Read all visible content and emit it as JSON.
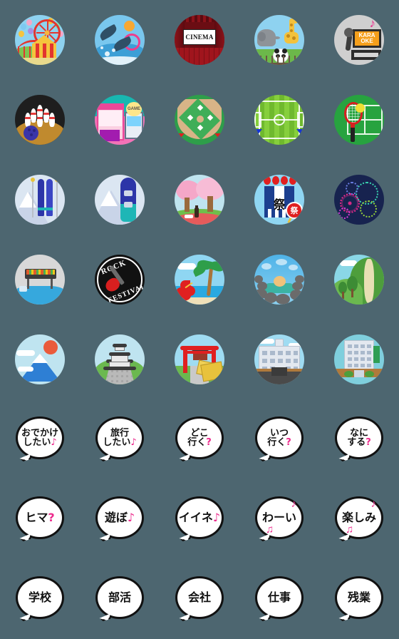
{
  "page": {
    "title": "Emoji sticker sheet",
    "background_color": "#4d6670",
    "grid": {
      "columns": 5,
      "rows": 8,
      "cell": 112,
      "icon_size": 70
    },
    "accent_pink": "#ec2a8c",
    "outline_color": "#111111"
  },
  "stickers": [
    {
      "id": 1,
      "row": 1,
      "col": 1,
      "type": "illustration",
      "name": "amusement-park",
      "label": "Amusement park (ferris wheel, roller coaster, circus tent)",
      "colors": {
        "bg": "#8ed2f0",
        "accent": "#e2352f"
      }
    },
    {
      "id": 2,
      "row": 1,
      "col": 2,
      "type": "illustration",
      "name": "aquarium-dolphins",
      "label": "Aquarium dolphin show",
      "colors": {
        "bg": "#79c7ee",
        "accent": "#ee3d8c"
      }
    },
    {
      "id": 3,
      "row": 1,
      "col": 3,
      "type": "illustration",
      "name": "cinema",
      "label": "Movie theater",
      "text": "CINEMA",
      "colors": {
        "bg": "#6b0d13",
        "accent": "#ffffff"
      }
    },
    {
      "id": 4,
      "row": 1,
      "col": 4,
      "type": "illustration",
      "name": "zoo",
      "label": "Zoo (elephant, giraffe, panda)",
      "colors": {
        "bg": "#8ed2f0",
        "accent": "#f3c23c"
      }
    },
    {
      "id": 5,
      "row": 1,
      "col": 5,
      "type": "illustration",
      "name": "karaoke",
      "label": "Karaoke machine and microphone",
      "text": {
        "line1": "KARA",
        "line2": "OKE"
      },
      "colors": {
        "bg": "#cfcfcf",
        "accent": "#f59f1b"
      }
    },
    {
      "id": 6,
      "row": 2,
      "col": 1,
      "type": "illustration",
      "name": "bowling",
      "label": "Bowling pins and ball",
      "colors": {
        "bg": "#1e1e1e",
        "accent": "#3a35a8"
      }
    },
    {
      "id": 7,
      "row": 2,
      "col": 2,
      "type": "illustration",
      "name": "game-arcade",
      "label": "Game arcade / crane game",
      "text": "GAME",
      "colors": {
        "bg": "#18b7b0",
        "accent": "#ec4899"
      }
    },
    {
      "id": 8,
      "row": 2,
      "col": 3,
      "type": "illustration",
      "name": "baseball-field",
      "label": "Baseball stadium",
      "colors": {
        "bg": "#2e9e4a",
        "accent": "#d8b487"
      }
    },
    {
      "id": 9,
      "row": 2,
      "col": 4,
      "type": "illustration",
      "name": "soccer-field",
      "label": "Soccer stadium",
      "colors": {
        "bg": "#86cf3c",
        "accent": "#1534d8"
      }
    },
    {
      "id": 10,
      "row": 2,
      "col": 5,
      "type": "illustration",
      "name": "tennis-court",
      "label": "Tennis court with racket and ball",
      "colors": {
        "bg": "#27a33f",
        "accent": "#d62020"
      }
    },
    {
      "id": 11,
      "row": 3,
      "col": 1,
      "type": "illustration",
      "name": "ski",
      "label": "Skis and poles on snowy mountain",
      "colors": {
        "bg": "#dbe6f2",
        "accent": "#2c35a8"
      }
    },
    {
      "id": 12,
      "row": 3,
      "col": 2,
      "type": "illustration",
      "name": "snowboard",
      "label": "Snowboard on snowy mountain",
      "colors": {
        "bg": "#dbe6f2",
        "accent": "#2c35a8"
      }
    },
    {
      "id": 13,
      "row": 3,
      "col": 3,
      "type": "illustration",
      "name": "hanami-cherry-blossom",
      "label": "Cherry blossom viewing picnic",
      "colors": {
        "bg": "#bfe4ef",
        "accent": "#f5a7c8"
      }
    },
    {
      "id": 14,
      "row": 3,
      "col": 4,
      "type": "illustration",
      "name": "matsuri-festival",
      "label": "Summer festival happi coat and fan",
      "text": {
        "coat": "祭",
        "fan": "祭"
      },
      "colors": {
        "bg": "#8fd6f2",
        "accent": "#e02020"
      }
    },
    {
      "id": 15,
      "row": 3,
      "col": 5,
      "type": "illustration",
      "name": "fireworks",
      "label": "Fireworks in night sky",
      "colors": {
        "bg": "#17234f",
        "accent": "#ec2a8c"
      }
    },
    {
      "id": 16,
      "row": 4,
      "col": 1,
      "type": "illustration",
      "name": "bbq",
      "label": "Barbecue grill by the river",
      "colors": {
        "bg": "#d8d8d8",
        "accent": "#36a8dd"
      }
    },
    {
      "id": 17,
      "row": 4,
      "col": 2,
      "type": "illustration",
      "name": "rock-festival",
      "label": "Rock festival badge with guitar",
      "text": {
        "top": "ROCK",
        "bottom": "FESTIVAL"
      },
      "colors": {
        "bg": "#111111",
        "accent": "#d81f1f"
      }
    },
    {
      "id": 18,
      "row": 4,
      "col": 3,
      "type": "illustration",
      "name": "tropical-beach",
      "label": "Tropical beach with palm tree and hibiscus",
      "colors": {
        "bg": "#8fd6f2",
        "accent": "#e02020"
      }
    },
    {
      "id": 19,
      "row": 4,
      "col": 4,
      "type": "illustration",
      "name": "onsen-hot-spring",
      "label": "Outdoor hot spring bath",
      "colors": {
        "bg": "#4fb3e8",
        "accent": "#6b6b6b"
      }
    },
    {
      "id": 20,
      "row": 4,
      "col": 5,
      "type": "illustration",
      "name": "hiking-nature",
      "label": "Green hills and walking trail",
      "colors": {
        "bg": "#8ad7e6",
        "accent": "#4e9e3c"
      }
    },
    {
      "id": 21,
      "row": 5,
      "col": 1,
      "type": "illustration",
      "name": "mount-fuji",
      "label": "Mount Fuji with rising sun",
      "colors": {
        "bg": "#bfe4f0",
        "accent": "#2e7fd4"
      }
    },
    {
      "id": 22,
      "row": 5,
      "col": 2,
      "type": "illustration",
      "name": "castle",
      "label": "Japanese castle on stone base",
      "colors": {
        "bg": "#bfe4f0",
        "accent": "#3b3b3b"
      }
    },
    {
      "id": 23,
      "row": 5,
      "col": 3,
      "type": "illustration",
      "name": "shrine-torii",
      "label": "Shrine torii gate with ema plaques",
      "colors": {
        "bg": "#9fdcf2",
        "accent": "#e02020"
      }
    },
    {
      "id": 24,
      "row": 5,
      "col": 4,
      "type": "illustration",
      "name": "school-building",
      "label": "School building with clock",
      "colors": {
        "bg": "#9fdcf2",
        "accent": "#e3e8ef"
      }
    },
    {
      "id": 25,
      "row": 5,
      "col": 5,
      "type": "illustration",
      "name": "office-building",
      "label": "Office building with green sign",
      "colors": {
        "bg": "#9fdcf2",
        "accent": "#2f9e54"
      }
    }
  ],
  "bubbles": [
    {
      "id": 26,
      "row": 6,
      "col": 1,
      "name": "bubble-odekake-shitai",
      "lines": [
        "おでかけ",
        "したい"
      ],
      "suffix": "♪",
      "suffix_color": "#ec2a8c",
      "size": "small",
      "notes": []
    },
    {
      "id": 27,
      "row": 6,
      "col": 2,
      "name": "bubble-ryokou-shitai",
      "lines": [
        "旅行",
        "したい"
      ],
      "suffix": "♪",
      "suffix_color": "#ec2a8c",
      "size": "small",
      "notes": []
    },
    {
      "id": 28,
      "row": 6,
      "col": 3,
      "name": "bubble-doko-iku",
      "lines": [
        "どこ",
        "行く"
      ],
      "suffix": "?",
      "suffix_color": "#ec2a8c",
      "size": "small",
      "notes": []
    },
    {
      "id": 29,
      "row": 6,
      "col": 4,
      "name": "bubble-itsu-iku",
      "lines": [
        "いつ",
        "行く"
      ],
      "suffix": "?",
      "suffix_color": "#ec2a8c",
      "size": "small",
      "notes": []
    },
    {
      "id": 30,
      "row": 6,
      "col": 5,
      "name": "bubble-nani-suru",
      "lines": [
        "なに",
        "する"
      ],
      "suffix": "?",
      "suffix_color": "#ec2a8c",
      "size": "small",
      "notes": []
    },
    {
      "id": 31,
      "row": 7,
      "col": 1,
      "name": "bubble-hima",
      "lines": [
        "ヒマ"
      ],
      "suffix": "?",
      "suffix_color": "#ec2a8c",
      "size": "large",
      "notes": []
    },
    {
      "id": 32,
      "row": 7,
      "col": 2,
      "name": "bubble-asobo",
      "lines": [
        "遊ぼ"
      ],
      "suffix": "♪",
      "suffix_color": "#ec2a8c",
      "size": "large",
      "notes": []
    },
    {
      "id": 33,
      "row": 7,
      "col": 3,
      "name": "bubble-iine",
      "lines": [
        "イイネ"
      ],
      "suffix": "♪",
      "suffix_color": "#ec2a8c",
      "size": "large",
      "notes": []
    },
    {
      "id": 34,
      "row": 7,
      "col": 4,
      "name": "bubble-waai",
      "lines": [
        "わーい"
      ],
      "suffix": "",
      "suffix_color": "#ec2a8c",
      "size": "large",
      "notes": [
        "♪",
        "♫"
      ]
    },
    {
      "id": 35,
      "row": 7,
      "col": 5,
      "name": "bubble-tanoshimi",
      "lines": [
        "楽しみ"
      ],
      "suffix": "",
      "suffix_color": "#ec2a8c",
      "size": "large",
      "notes": [
        "♪",
        "♫"
      ]
    },
    {
      "id": 36,
      "row": 8,
      "col": 1,
      "name": "bubble-gakkou",
      "lines": [
        "学校"
      ],
      "suffix": "",
      "suffix_color": "#111111",
      "size": "large",
      "notes": []
    },
    {
      "id": 37,
      "row": 8,
      "col": 2,
      "name": "bubble-bukatsu",
      "lines": [
        "部活"
      ],
      "suffix": "",
      "suffix_color": "#111111",
      "size": "large",
      "notes": []
    },
    {
      "id": 38,
      "row": 8,
      "col": 3,
      "name": "bubble-kaisha",
      "lines": [
        "会社"
      ],
      "suffix": "",
      "suffix_color": "#111111",
      "size": "large",
      "notes": []
    },
    {
      "id": 39,
      "row": 8,
      "col": 4,
      "name": "bubble-shigoto",
      "lines": [
        "仕事"
      ],
      "suffix": "",
      "suffix_color": "#111111",
      "size": "large",
      "notes": []
    },
    {
      "id": 40,
      "row": 8,
      "col": 5,
      "name": "bubble-zangyou",
      "lines": [
        "残業"
      ],
      "suffix": "",
      "suffix_color": "#111111",
      "size": "large",
      "notes": []
    }
  ]
}
